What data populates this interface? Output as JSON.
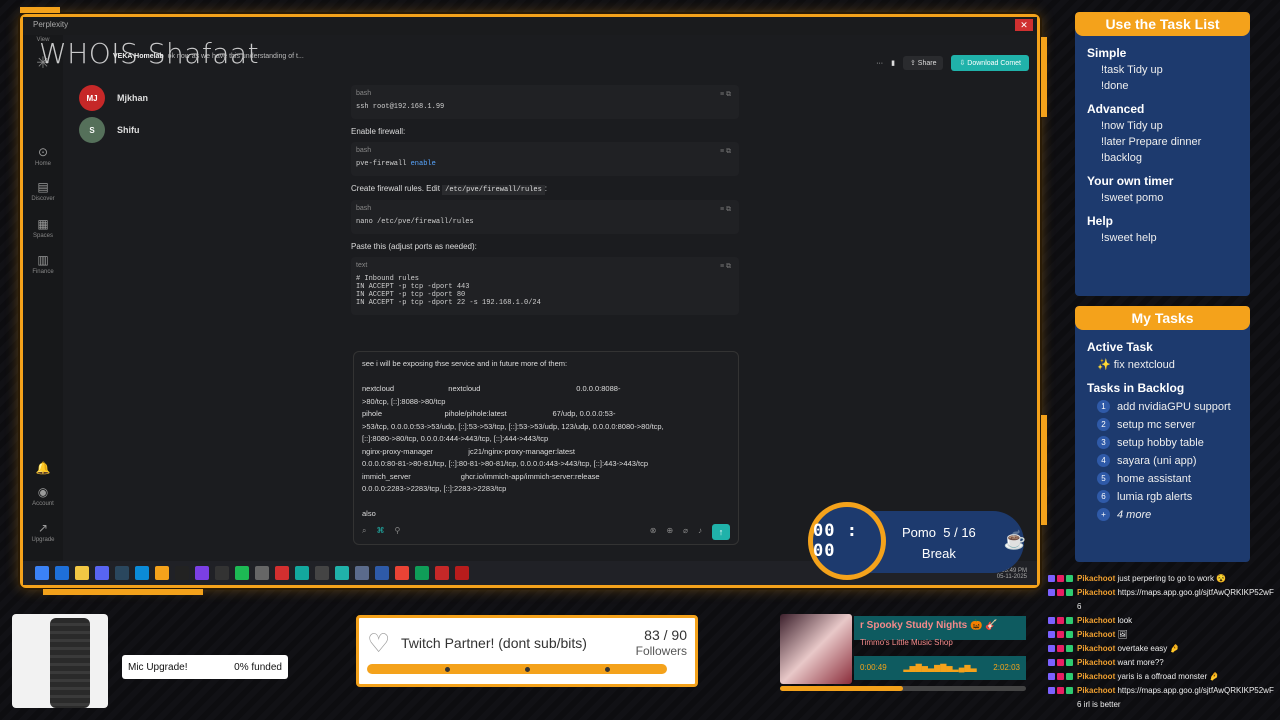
{
  "window": {
    "title": "Perplexity",
    "menu": "View"
  },
  "overlay_name": "WHOIS Shafaat",
  "contacts": [
    {
      "initials": "MJ",
      "name": "Mjkhan"
    },
    {
      "initials": "S",
      "name": "Shifu"
    }
  ],
  "sidebar": {
    "home": "Home",
    "discover": "Discover",
    "spaces": "Spaces",
    "finance": "Finance",
    "account": "Account",
    "upgrade": "Upgrade"
  },
  "topbar": {
    "user": "VEKA Homelab",
    "thread": "ok now as we have this understanding of t...",
    "share": "Share",
    "download": "Download Comet"
  },
  "chat": {
    "code1": {
      "lang": "bash",
      "code": "ssh root@192.168.1.99"
    },
    "p1": "Enable firewall:",
    "code2": {
      "lang": "bash",
      "cmd": "pve-firewall ",
      "arg": "enable"
    },
    "p2_pre": "Create firewall rules. Edit ",
    "p2_path": "/etc/pve/firewall/rules",
    "p2_post": ":",
    "code3": {
      "lang": "bash",
      "code": "nano /etc/pve/firewall/rules"
    },
    "p3": "Paste this (adjust ports as needed):",
    "code4": {
      "lang": "text",
      "code": "# Inbound rules\nIN ACCEPT -p tcp -dport 443\nIN ACCEPT -p tcp -dport 80\nIN ACCEPT -p tcp -dport 22 -s 192.168.1.0/24"
    }
  },
  "input": {
    "lines": [
      "see i will be exposing thse service and in future more of them:",
      "",
      "nextcloud                          nextcloud                                              0.0.0.0:8088-",
      ">80/tcp, [::]:8088->80/tcp",
      "pihole                              pihole/pihole:latest                      67/udp, 0.0.0.0:53-",
      ">53/tcp, 0.0.0.0:53->53/udp, [::]:53->53/tcp, [::]:53->53/udp, 123/udp, 0.0.0.0:8080->80/tcp,",
      "[::]:8080->80/tcp, 0.0.0.0:444->443/tcp, [::]:444->443/tcp",
      "nginx-proxy-manager                 jc21/nginx-proxy-manager:latest",
      "0.0.0.0:80-81->80-81/tcp, [::]:80-81->80-81/tcp, 0.0.0.0:443->443/tcp, [::]:443->443/tcp",
      "immich_server                        ghcr.io/immich-app/immich-server:release",
      "0.0.0.0:2283->2283/tcp, [::]:2283->2283/tcp",
      "",
      "also"
    ]
  },
  "tray": {
    "time": "03:49 PM",
    "date": "05-11-2025",
    "lang": "ENG"
  },
  "pomo": {
    "time": "00 : 00",
    "label": "Pomo",
    "current": "5",
    "sep": "/",
    "total": "16",
    "state": "Break"
  },
  "task_list_help": {
    "header": "Use the Task List",
    "sections": [
      {
        "title": "Simple",
        "items": [
          "!task Tidy up",
          "!done"
        ]
      },
      {
        "title": "Advanced",
        "items": [
          "!now Tidy up",
          "!later Prepare dinner",
          "!backlog"
        ]
      },
      {
        "title": "Your own timer",
        "items": [
          "!sweet pomo"
        ]
      },
      {
        "title": "Help",
        "items": [
          "!sweet help"
        ]
      }
    ]
  },
  "my_tasks": {
    "header": "My Tasks",
    "active_title": "Active Task",
    "active": "✨ fix nextcloud",
    "backlog_title": "Tasks in Backlog",
    "backlog": [
      "add nvidiaGPU support",
      "setup mc server",
      "setup hobby table",
      "sayara (uni app)",
      "home assistant",
      "lumia rgb alerts"
    ],
    "more": "4 more"
  },
  "mic_upgrade": {
    "label": "Mic Upgrade!",
    "funded": "0% funded"
  },
  "partner": {
    "title": "Twitch Partner! (dont sub/bits)",
    "count": "83 / 90",
    "unit": "Followers",
    "progress": 0.92
  },
  "music": {
    "title": "r Spooky Study Nights 🎃 🎸",
    "subtitle": "Timmo's Little Music Shop",
    "elapsed": "0:00:49",
    "duration": "2:02:03",
    "progress": 0.5
  },
  "chatlog": [
    {
      "user": "Pikachoot",
      "msg": "just perpering to go to work 😵"
    },
    {
      "user": "Pikachoot",
      "msg": "https://maps.app.goo.gl/sjtfAwQRKIKP52wF6"
    },
    {
      "user": "Pikachoot",
      "msg": "look"
    },
    {
      "user": "Pikachoot",
      "msg": "🖼"
    },
    {
      "user": "Pikachoot",
      "msg": "overtake easy 🤌"
    },
    {
      "user": "Pikachoot",
      "msg": "want more??"
    },
    {
      "user": "Pikachoot",
      "msg": "yaris is a offroad monster 🤌"
    },
    {
      "user": "Pikachoot",
      "msg": "https://maps.app.goo.gl/sjtfAwQRKIKP52wF6 irl is better"
    }
  ],
  "colors": {
    "accent": "#f4a21b",
    "panel": "#1d3a6e",
    "teal": "#20b2aa"
  }
}
